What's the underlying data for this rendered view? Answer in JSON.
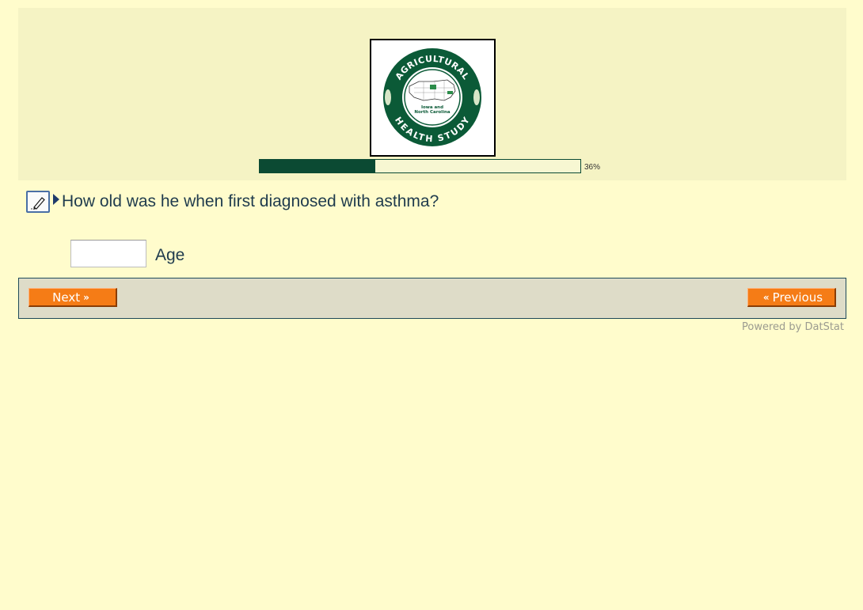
{
  "logo": {
    "top_text": "AGRICULTURAL",
    "bottom_text": "HEALTH STUDY",
    "center_line1": "Iowa and",
    "center_line2": "North Carolina"
  },
  "progress": {
    "percent": 36,
    "label": "36%"
  },
  "question": {
    "text": "How old was he when first diagnosed with asthma?"
  },
  "answer": {
    "value": "",
    "unit_label": "Age"
  },
  "nav": {
    "next_label": "Next",
    "previous_label": "Previous"
  },
  "footer": {
    "powered_by": "Powered by DatStat"
  },
  "colors": {
    "page_bg": "#fffccc",
    "header_bg": "#f5f3c4",
    "progress": "#0b4a33",
    "button": "#f57c16",
    "nav_bg": "#dedcc8"
  }
}
